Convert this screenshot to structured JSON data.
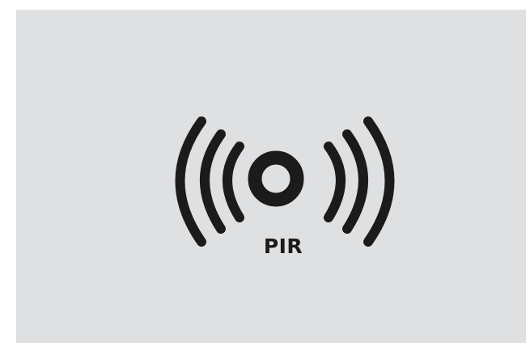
{
  "icon": {
    "name": "pir-sensor-icon",
    "label": "PIR",
    "color": "#1b1b1b",
    "background": "#dfe0e2"
  }
}
